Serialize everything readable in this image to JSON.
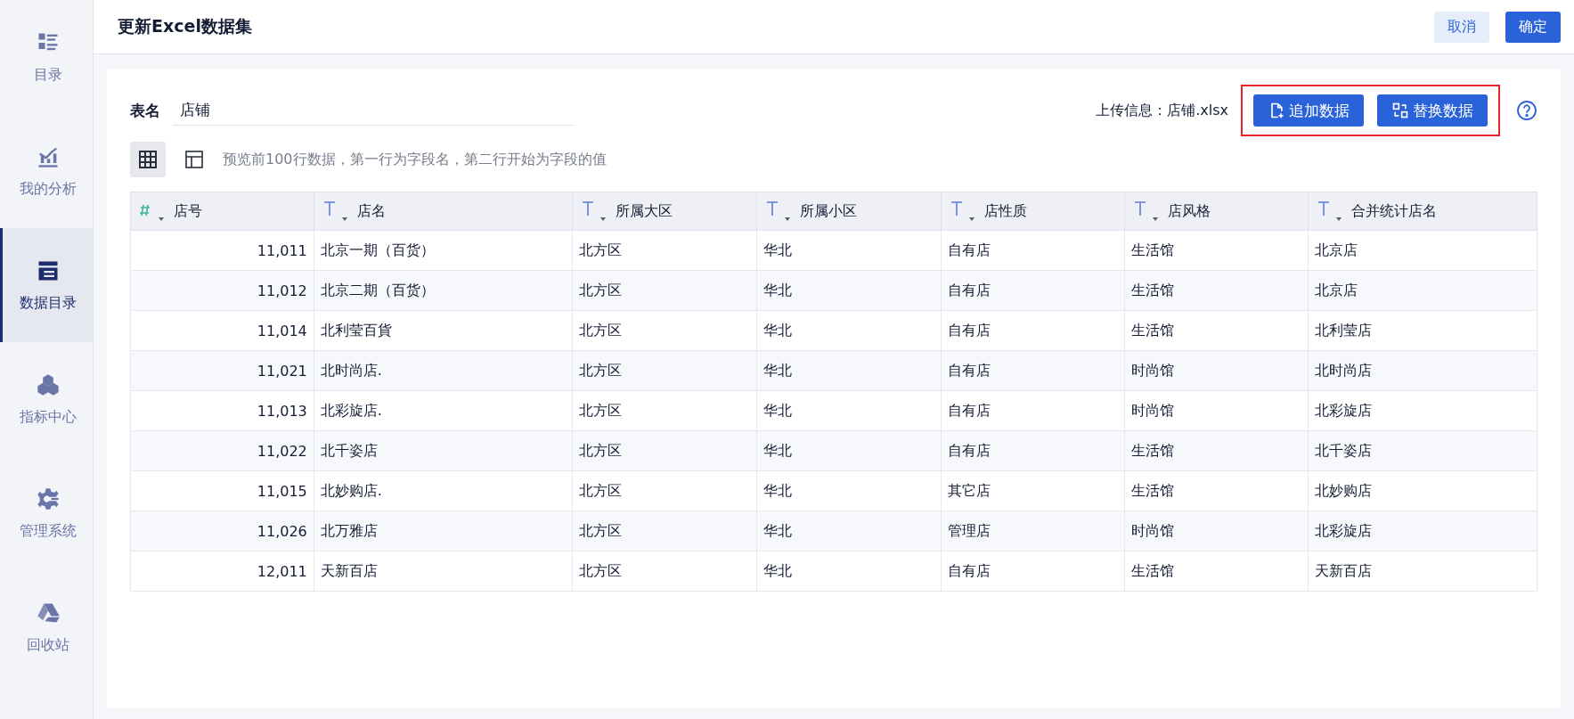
{
  "sidebar": {
    "items": [
      {
        "label": "目录",
        "selected": false
      },
      {
        "label": "我的分析",
        "selected": false
      },
      {
        "label": "数据目录",
        "selected": true
      },
      {
        "label": "指标中心",
        "selected": false
      },
      {
        "label": "管理系统",
        "selected": false
      },
      {
        "label": "回收站",
        "selected": false
      }
    ]
  },
  "header": {
    "title": "更新Excel数据集",
    "buttons": [
      {
        "label": "取消",
        "kind": "secondary"
      },
      {
        "label": "确定",
        "kind": "primary"
      }
    ]
  },
  "form": {
    "name_label": "表名",
    "name_value": "店铺",
    "upload_info": "上传信息：店铺.xlsx",
    "actions": {
      "highlighted": true,
      "buttons": [
        {
          "label": "追加数据"
        },
        {
          "label": "替换数据"
        }
      ]
    }
  },
  "view_toggle": [
    {
      "selected": true
    },
    {
      "selected": false
    }
  ],
  "hint": "预览前100行数据，第一行为字段名，第二行开始为字段的值",
  "table": {
    "columns": [
      {
        "kind": "number",
        "label": "店号"
      },
      {
        "kind": "text",
        "label": "店名"
      },
      {
        "kind": "text",
        "label": "所属大区"
      },
      {
        "kind": "text",
        "label": "所属小区"
      },
      {
        "kind": "text",
        "label": "店性质"
      },
      {
        "kind": "text",
        "label": "店风格"
      },
      {
        "kind": "text",
        "label": "合并统计店名"
      }
    ],
    "rows": [
      [
        "11,011",
        "北京一期（百货）",
        "北方区",
        "华北",
        "自有店",
        "生活馆",
        "北京店"
      ],
      [
        "11,012",
        "北京二期（百货）",
        "北方区",
        "华北",
        "自有店",
        "生活馆",
        "北京店"
      ],
      [
        "11,014",
        "北利莹百貨",
        "北方区",
        "华北",
        "自有店",
        "生活馆",
        "北利莹店"
      ],
      [
        "11,021",
        "北时尚店.",
        "北方区",
        "华北",
        "自有店",
        "时尚馆",
        "北时尚店"
      ],
      [
        "11,013",
        "北彩旋店.",
        "北方区",
        "华北",
        "自有店",
        "时尚馆",
        "北彩旋店"
      ],
      [
        "11,022",
        "北千姿店",
        "北方区",
        "华北",
        "自有店",
        "生活馆",
        "北千姿店"
      ],
      [
        "11,015",
        "北妙购店.",
        "北方区",
        "华北",
        "其它店",
        "生活馆",
        "北妙购店"
      ],
      [
        "11,026",
        "北万雅店",
        "北方区",
        "华北",
        "管理店",
        "时尚馆",
        "北彩旋店"
      ],
      [
        "12,011",
        "天新百店",
        "北方区",
        "华北",
        "自有店",
        "生活馆",
        "天新百店"
      ]
    ]
  }
}
